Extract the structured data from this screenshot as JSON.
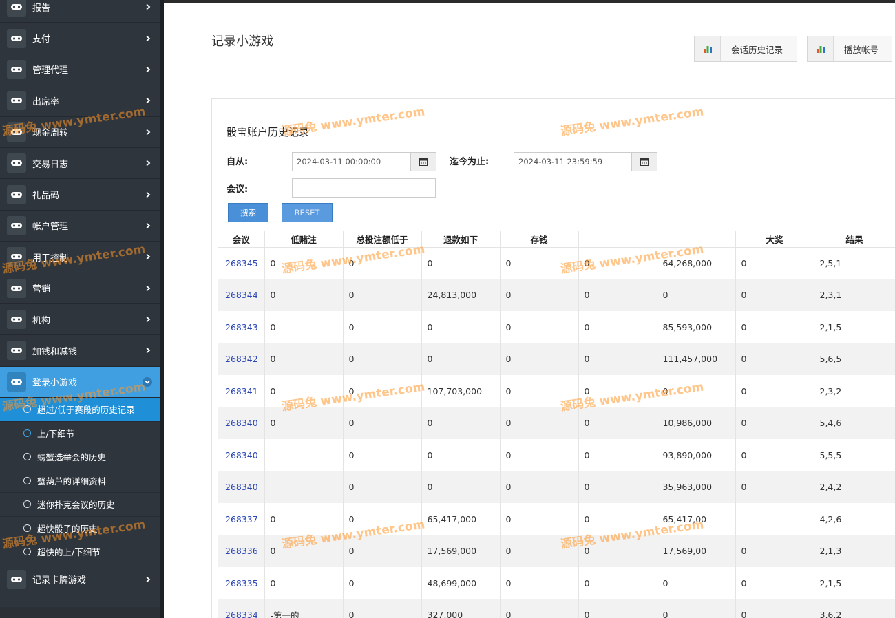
{
  "sidebar": {
    "items": [
      {
        "label": "报告"
      },
      {
        "label": "支付"
      },
      {
        "label": "管理代理"
      },
      {
        "label": "出席率"
      },
      {
        "label": "现金周转"
      },
      {
        "label": "交易日志"
      },
      {
        "label": "礼品码"
      },
      {
        "label": "帐户管理"
      },
      {
        "label": "用于控制"
      },
      {
        "label": "营销"
      },
      {
        "label": "机构"
      },
      {
        "label": "加钱和减钱"
      }
    ],
    "active_item": {
      "label": "登录小游戏"
    },
    "sub_items": [
      {
        "label": "超过/低于赛段的历史记录"
      },
      {
        "label": "上/下细节"
      },
      {
        "label": "螃蟹选举会的历史"
      },
      {
        "label": "蟹葫芦的详细资料"
      },
      {
        "label": "迷你扑克会议的历史"
      },
      {
        "label": "超快骰子的历史"
      },
      {
        "label": "超快的上/下细节"
      }
    ],
    "after_item": {
      "label": "记录卡牌游戏"
    }
  },
  "header": {
    "title": "记录小游戏",
    "btn_session_history": "会话历史记录",
    "btn_play_account": "播放帐号"
  },
  "panel": {
    "title": "骰宝账户历史记录",
    "from_label": "自从:",
    "from_value": "2024-03-11 00:00:00",
    "to_label": "迄今为止:",
    "to_value": "2024-03-11 23:59:59",
    "session_label": "会议:",
    "session_value": "",
    "search_btn": "搜索",
    "reset_btn": "RESET"
  },
  "table": {
    "headers": [
      "会议",
      "低赌注",
      "总投注额低于",
      "退款如下",
      "存钱",
      "",
      "",
      "大奖",
      "结果"
    ],
    "rows": [
      [
        "268345",
        "0",
        "0",
        "0",
        "0",
        "0",
        "64,268,000",
        "0",
        "2,5,1"
      ],
      [
        "268344",
        "0",
        "0",
        "24,813,000",
        "0",
        "0",
        "0",
        "0",
        "2,3,1"
      ],
      [
        "268343",
        "0",
        "0",
        "0",
        "0",
        "0",
        "85,593,000",
        "0",
        "2,1,5"
      ],
      [
        "268342",
        "0",
        "0",
        "0",
        "0",
        "0",
        "111,457,000",
        "0",
        "5,6,5"
      ],
      [
        "268341",
        "0",
        "0",
        "107,703,000",
        "0",
        "0",
        "0",
        "0",
        "2,3,2"
      ],
      [
        "268340",
        "0",
        "0",
        "0",
        "0",
        "0",
        "10,986,000",
        "0",
        "5,4,6"
      ],
      [
        "268340",
        "",
        "0",
        "0",
        "0",
        "0",
        "93,890,000",
        "0",
        "5,5,5"
      ],
      [
        "268340",
        "",
        "0",
        "0",
        "0",
        "0",
        "35,963,000",
        "0",
        "2,4,2"
      ],
      [
        "268337",
        "0",
        "0",
        "65,417,000",
        "0",
        "0",
        "65,417,00",
        "",
        "4,2,6"
      ],
      [
        "268336",
        "0",
        "0",
        "17,569,000",
        "0",
        "0",
        "17,569,00",
        "0",
        "2,1,3"
      ],
      [
        "268335",
        "0",
        "0",
        "48,699,000",
        "0",
        "0",
        "0",
        "0",
        "2,1,5"
      ],
      [
        "268334",
        "-第一的",
        "0",
        "327,000",
        "0",
        "0",
        "0",
        "0",
        "3,6,2"
      ]
    ]
  },
  "watermark": {
    "text": "源码兔 www.ymter.com"
  }
}
